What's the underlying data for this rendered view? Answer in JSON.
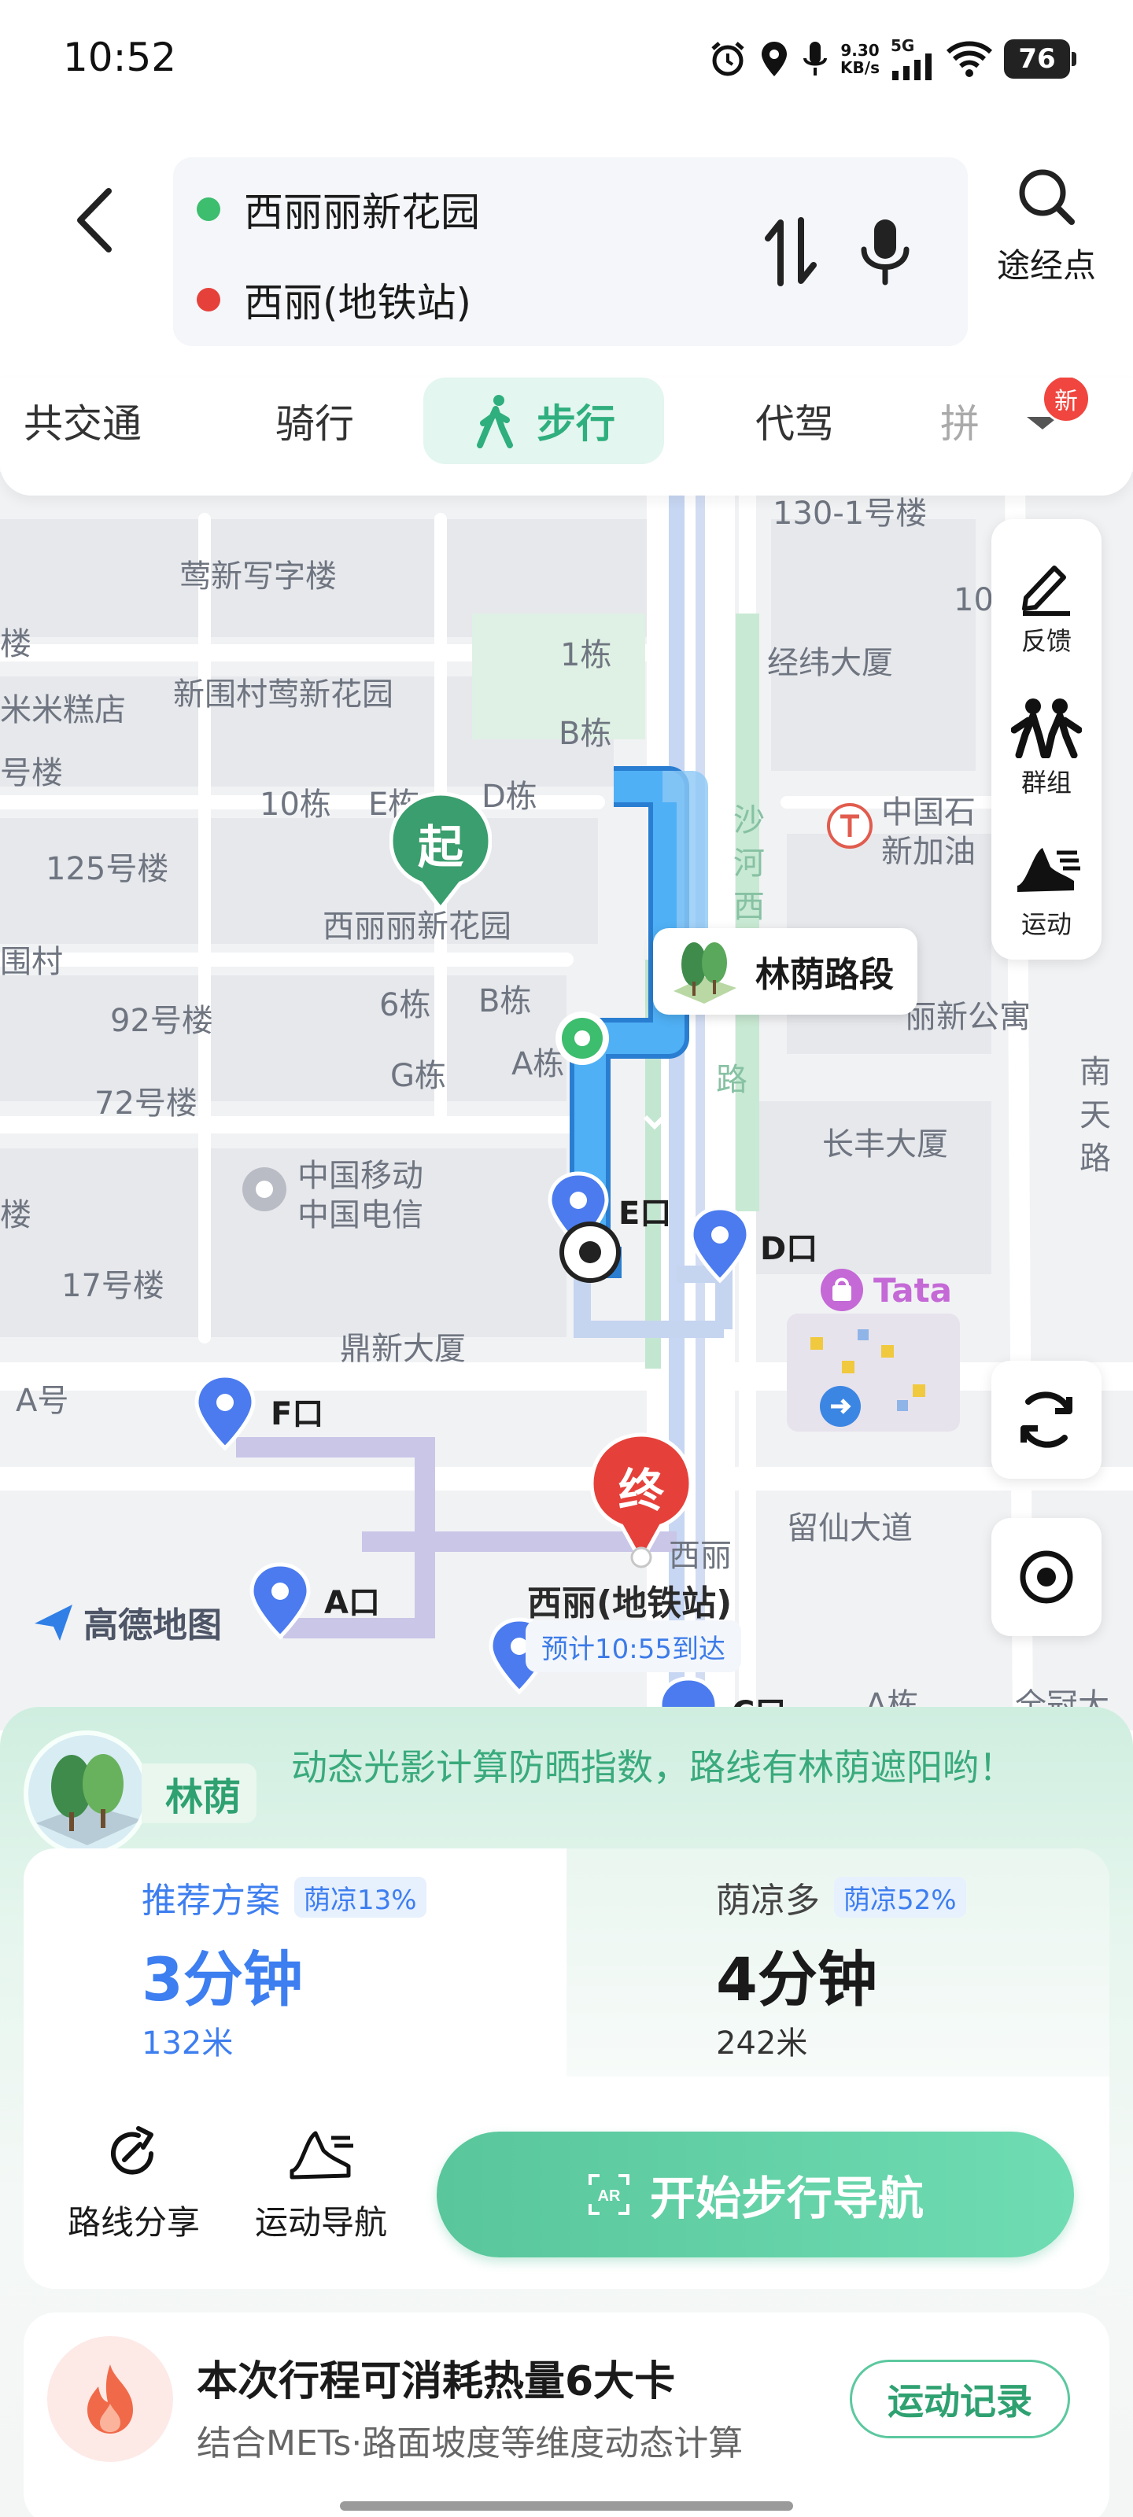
{
  "status_bar": {
    "time": "10:52",
    "net_speed_value": "9.30",
    "net_speed_unit": "KB/s",
    "network": "5G",
    "battery": "76",
    "icons": [
      "alarm-icon",
      "location-icon",
      "mic-icon",
      "signal-icon",
      "wifi-icon",
      "battery-icon"
    ]
  },
  "route": {
    "origin": "西丽丽新花园",
    "destination": "西丽(地铁站)",
    "origin_color": "#3dbd6e",
    "destination_color": "#e5413a",
    "waypoint_label": "途经点"
  },
  "modes": {
    "tabs": [
      {
        "label": "共交通",
        "active": false
      },
      {
        "label": "骑行",
        "active": false
      },
      {
        "label": "步行",
        "active": true
      },
      {
        "label": "代驾",
        "active": false
      },
      {
        "label": "拼",
        "active": false
      }
    ],
    "new_badge": "新"
  },
  "map": {
    "labels": {
      "l1": "莺新写字楼",
      "l2": "1栋",
      "l3": "经纬大厦",
      "l4": "米米糕店",
      "l5": "新围村莺新花园",
      "l6": "B栋",
      "l7": "10栋",
      "l8": "E栋",
      "l9": "D栋",
      "l10": "沙",
      "l11": "河",
      "l12": "西",
      "l13": "中国石",
      "l14": "新加油",
      "l15": "125号楼",
      "l16": "西丽丽新花园",
      "l17": "围村",
      "l18": "92号楼",
      "l19": "6栋",
      "l20": "B栋",
      "l21": "A栋",
      "l22": "G栋",
      "l23": "72号楼",
      "l24": "路",
      "l25": "长丰大厦",
      "l26": "中国移动",
      "l27": "中国电信",
      "l28": "17号楼",
      "l29": "鼎新大厦",
      "l30": "A号",
      "l31": "留仙大道",
      "l32": "西丽",
      "l33": "130-1号楼",
      "l34": "10",
      "l35": "楼",
      "l36": "号楼",
      "l37": "楼",
      "l38": "南",
      "l39": "天",
      "l40": "路",
      "l41": "丽新公寓",
      "l42": "Tata",
      "l43": "A栋",
      "l44": "全冠大"
    },
    "exits": {
      "e": "E口",
      "d": "D口",
      "f": "F口",
      "a": "A口",
      "c": "C口"
    },
    "start_marker": "起",
    "end_marker": "终",
    "end_name": "西丽(地铁站)",
    "eta": "预计10:55到达",
    "callout": "林荫路段",
    "logo": "高德地图",
    "side_panel": {
      "feedback": "反馈",
      "group": "群组",
      "sport": "运动"
    }
  },
  "sheet": {
    "shade_name": "林荫",
    "shade_text": "动态光影计算防晒指数，路线有林荫遮阳哟！",
    "plans": [
      {
        "name": "推荐方案",
        "badge": "荫凉13%",
        "time": "3分钟",
        "distance": "132米"
      },
      {
        "name": "荫凉多",
        "badge": "荫凉52%",
        "time": "4分钟",
        "distance": "242米"
      }
    ],
    "actions": {
      "share": "路线分享",
      "sport_nav": "运动导航"
    },
    "start_button": "开始步行导航",
    "calorie_title": "本次行程可消耗热量6大卡",
    "calorie_sub": "结合METs·路面坡度等维度动态计算",
    "record_button": "运动记录"
  },
  "colors": {
    "accent_green": "#5cc89f",
    "route_blue": "#4aa8f2",
    "plan_blue": "#3d7ef0",
    "end_red": "#e5413a",
    "start_green": "#3a9e6e"
  }
}
